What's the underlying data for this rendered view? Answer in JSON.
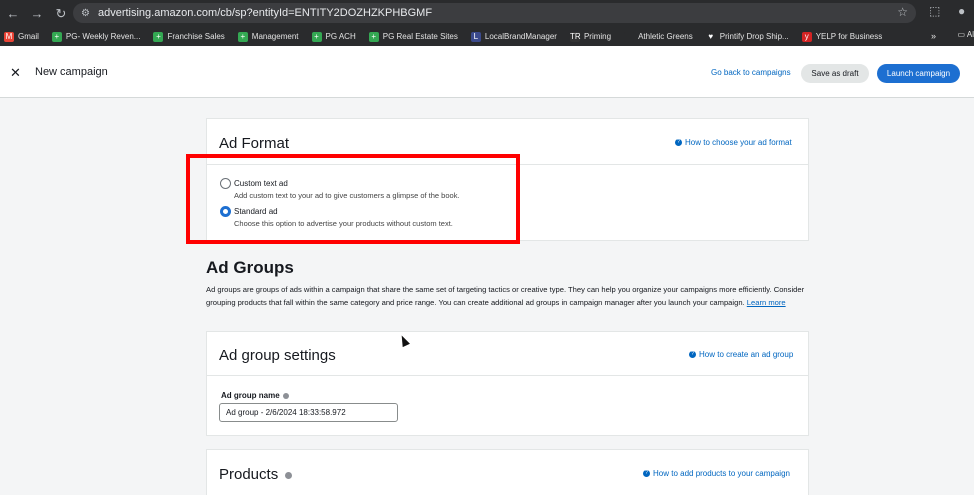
{
  "browser": {
    "url": "advertising.amazon.com/cb/sp?entityId=ENTITY2DOZHZKPHBGMF",
    "bookmarks": [
      {
        "label": "Gmail",
        "color": "#ea4335",
        "glyph": "M"
      },
      {
        "label": "PG- Weekly Reven...",
        "color": "#34a853",
        "glyph": "+"
      },
      {
        "label": "Franchise Sales",
        "color": "#34a853",
        "glyph": "+"
      },
      {
        "label": "Management",
        "color": "#34a853",
        "glyph": "+"
      },
      {
        "label": "PG ACH",
        "color": "#34a853",
        "glyph": "+"
      },
      {
        "label": "PG Real Estate Sites",
        "color": "#34a853",
        "glyph": "+"
      },
      {
        "label": "LocalBrandManager",
        "color": "#3b4a8c",
        "glyph": "L"
      },
      {
        "label": "Priming",
        "color": "#333333",
        "glyph": "TR"
      },
      {
        "label": "Athletic Greens",
        "color": "#2a2b2d",
        "glyph": ""
      },
      {
        "label": "Printify Drop Ship...",
        "color": "#2a2b2d",
        "glyph": "♥"
      },
      {
        "label": "YELP for Business",
        "color": "#d32323",
        "glyph": "y"
      }
    ],
    "bookmarks_overflow": "»",
    "bookmarks_folder": "Al"
  },
  "header": {
    "title": "New campaign",
    "back_link": "Go back to campaigns",
    "save_draft": "Save as draft",
    "launch": "Launch campaign"
  },
  "ad_format": {
    "title": "Ad Format",
    "help": "How to choose your ad format",
    "options": [
      {
        "label": "Custom text ad",
        "desc": "Add custom text to your ad to give customers a glimpse of the book.",
        "checked": false
      },
      {
        "label": "Standard ad",
        "desc": "Choose this option to advertise your products without custom text.",
        "checked": true
      }
    ]
  },
  "ad_groups": {
    "title": "Ad Groups",
    "desc": "Ad groups are groups of ads within a campaign that share the same set of targeting tactics or creative type. They can help you organize your campaigns more efficiently. Consider grouping products that fall within the same category and price range. You can create additional ad groups in campaign manager after you launch your campaign.",
    "learn_more": "Learn more"
  },
  "ad_group_settings": {
    "title": "Ad group settings",
    "help": "How to create an ad group",
    "name_label": "Ad group name",
    "name_value": "Ad group - 2/6/2024 18:33:58.972"
  },
  "products": {
    "title": "Products",
    "help": "How to add products to your campaign"
  },
  "colors": {
    "accent": "#1d6fd1",
    "link": "#0066c0",
    "highlight": "#ff0000"
  }
}
